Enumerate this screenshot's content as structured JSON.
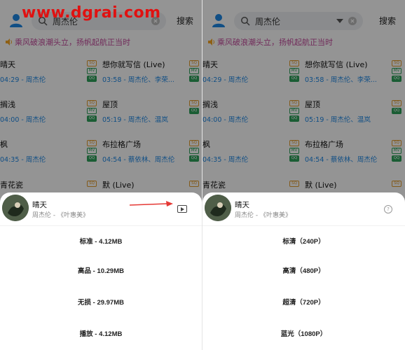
{
  "watermark": "www.dgrai.com",
  "colors": {
    "accent_blue": "#1e88e5",
    "notice_pink": "#c34a9c",
    "watermark_red": "#e01111",
    "arrow_red": "#e53935"
  },
  "left": {
    "search": {
      "query": "周杰伦",
      "button": "搜索"
    },
    "notice": "乘风破浪潮头立，扬帆起航正当时",
    "songs": [
      {
        "title": "晴天",
        "meta": "04:29 - 周杰伦",
        "badges": [
          "SQ",
          "MV",
          "QQ"
        ]
      },
      {
        "title": "想你就写信 (Live)",
        "meta": "03:58 - 周杰伦、李荣...",
        "badges": [
          "SQ",
          "MV",
          "QQ"
        ]
      },
      {
        "title": "搁浅",
        "meta": "04:00 - 周杰伦",
        "badges": [
          "SQ",
          "MV",
          "QQ"
        ]
      },
      {
        "title": "屋顶",
        "meta": "05:19 - 周杰伦、温岚",
        "badges": [
          "SQ",
          "QQ"
        ]
      },
      {
        "title": "枫",
        "meta": "04:35 - 周杰伦",
        "badges": [
          "SQ",
          "MV",
          "QQ"
        ]
      },
      {
        "title": "布拉格广场",
        "meta": "04:54 - 蔡依林、周杰伦",
        "badges": [
          "SQ",
          "MV",
          "QQ"
        ]
      },
      {
        "title": "青花瓷",
        "meta": "",
        "badges": [
          "SQ"
        ]
      },
      {
        "title": "默 (Live)",
        "meta": "",
        "badges": [
          "SQ"
        ]
      }
    ],
    "sheet": {
      "title": "晴天",
      "subtitle": "周杰伦 - 《叶惠美》",
      "options": [
        "标准 - 4.12MB",
        "高品 - 10.29MB",
        "无损 - 29.97MB",
        "播放 - 4.12MB"
      ]
    }
  },
  "right": {
    "search": {
      "query": "周杰伦",
      "button": "搜索"
    },
    "notice": "乘风破浪潮头立，扬帆起航正当时",
    "songs": [
      {
        "title": "晴天",
        "meta": "04:29 - 周杰伦",
        "badges": [
          "SQ",
          "MV",
          "QQ"
        ]
      },
      {
        "title": "想你就写信 (Live)",
        "meta": "03:58 - 周杰伦、李荣...",
        "badges": [
          "SQ",
          "MV",
          "QQ"
        ]
      },
      {
        "title": "搁浅",
        "meta": "04:00 - 周杰伦",
        "badges": [
          "SQ",
          "MV",
          "QQ"
        ]
      },
      {
        "title": "屋顶",
        "meta": "05:19 - 周杰伦、温岚",
        "badges": [
          "SQ",
          "QQ"
        ]
      },
      {
        "title": "枫",
        "meta": "04:35 - 周杰伦",
        "badges": [
          "SQ",
          "MV",
          "QQ"
        ]
      },
      {
        "title": "布拉格广场",
        "meta": "04:54 - 蔡依林、周杰伦",
        "badges": [
          "SQ",
          "MV",
          "QQ"
        ]
      },
      {
        "title": "青花瓷",
        "meta": "",
        "badges": [
          "SQ"
        ]
      },
      {
        "title": "默 (Live)",
        "meta": "",
        "badges": [
          "SQ"
        ]
      }
    ],
    "sheet": {
      "title": "晴天",
      "subtitle": "周杰伦 - 《叶惠美》",
      "options": [
        "标清（240P）",
        "高清（480P）",
        "超清（720P）",
        "蓝光（1080P）"
      ]
    }
  }
}
